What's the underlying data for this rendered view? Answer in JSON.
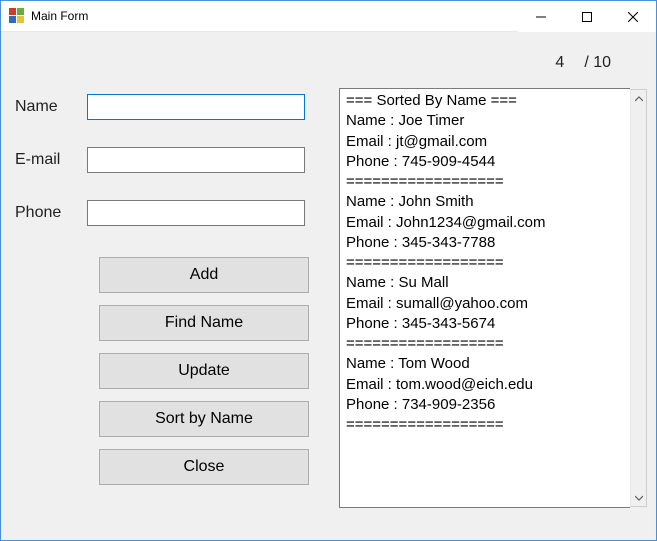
{
  "window": {
    "title": "Main Form"
  },
  "counter": {
    "current": "4",
    "separator": "/ 10"
  },
  "fields": {
    "name": {
      "label": "Name",
      "value": ""
    },
    "email": {
      "label": "E-mail",
      "value": ""
    },
    "phone": {
      "label": "Phone",
      "value": ""
    }
  },
  "buttons": {
    "add": "Add",
    "find": "Find Name",
    "update": "Update",
    "sort": "Sort by Name",
    "close": "Close"
  },
  "output": {
    "header": "=== Sorted By Name ===",
    "divider": "==================",
    "records": [
      {
        "name": "Joe Timer",
        "email": "jt@gmail.com",
        "phone": "745-909-4544"
      },
      {
        "name": "John Smith",
        "email": "John1234@gmail.com",
        "phone": "345-343-7788"
      },
      {
        "name": "Su Mall",
        "email": "sumall@yahoo.com",
        "phone": "345-343-5674"
      },
      {
        "name": "Tom Wood",
        "email": "tom.wood@eich.edu",
        "phone": "734-909-2356"
      }
    ],
    "labels": {
      "name": "Name : ",
      "email": "Email : ",
      "phone": "Phone : "
    }
  }
}
